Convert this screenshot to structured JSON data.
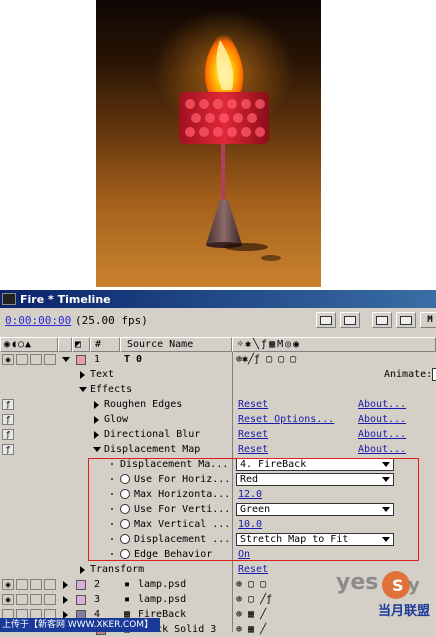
{
  "panel": {
    "title": "Fire * Timeline",
    "timecode": "0:00:00:00",
    "fps": "(25.00 fps)"
  },
  "columns": {
    "num": "#",
    "source_name": "Source Name",
    "animate": "Animate:"
  },
  "layers": [
    {
      "num": "1",
      "name": "T 0",
      "type": "text",
      "color": "#e8a0a0"
    },
    {
      "num": "2",
      "name": "lamp.psd",
      "type": "psd",
      "color": "#d8b0d8"
    },
    {
      "num": "3",
      "name": "lamp.psd",
      "type": "psd",
      "color": "#d8b0d8"
    },
    {
      "num": "4",
      "name": "FireBack",
      "type": "comp",
      "color": "#8080a0"
    },
    {
      "num": "5",
      "name": "Black Solid 3",
      "type": "solid",
      "color": "#c08080"
    }
  ],
  "properties": {
    "text": "Text",
    "effects": "Effects",
    "roughen_edges": "Roughen Edges",
    "glow": "Glow",
    "directional_blur": "Directional Blur",
    "displacement_map": "Displacement Map",
    "transform": "Transform"
  },
  "effect_actions": {
    "reset": "Reset",
    "reset_options": "Reset Options...",
    "about": "About..."
  },
  "displacement_params": [
    {
      "label": "Displacement Ma...",
      "value": "4. FireBack",
      "kind": "dropdown"
    },
    {
      "label": "Use For Horiz...",
      "value": "Red",
      "kind": "dropdown"
    },
    {
      "label": "Max Horizonta...",
      "value": "12.0",
      "kind": "number"
    },
    {
      "label": "Use For Verti...",
      "value": "Green",
      "kind": "dropdown"
    },
    {
      "label": "Max Vertical ...",
      "value": "10.0",
      "kind": "number"
    },
    {
      "label": "Displacement ...",
      "value": "Stretch Map to Fit",
      "kind": "dropdown"
    },
    {
      "label": "Edge Behavior",
      "value": "On",
      "kind": "text"
    }
  ],
  "watermark": {
    "left": "上传于【新客网 WWW.XKER.COM】",
    "right_brand": "yesky",
    "right_cn": "当月联盟"
  }
}
